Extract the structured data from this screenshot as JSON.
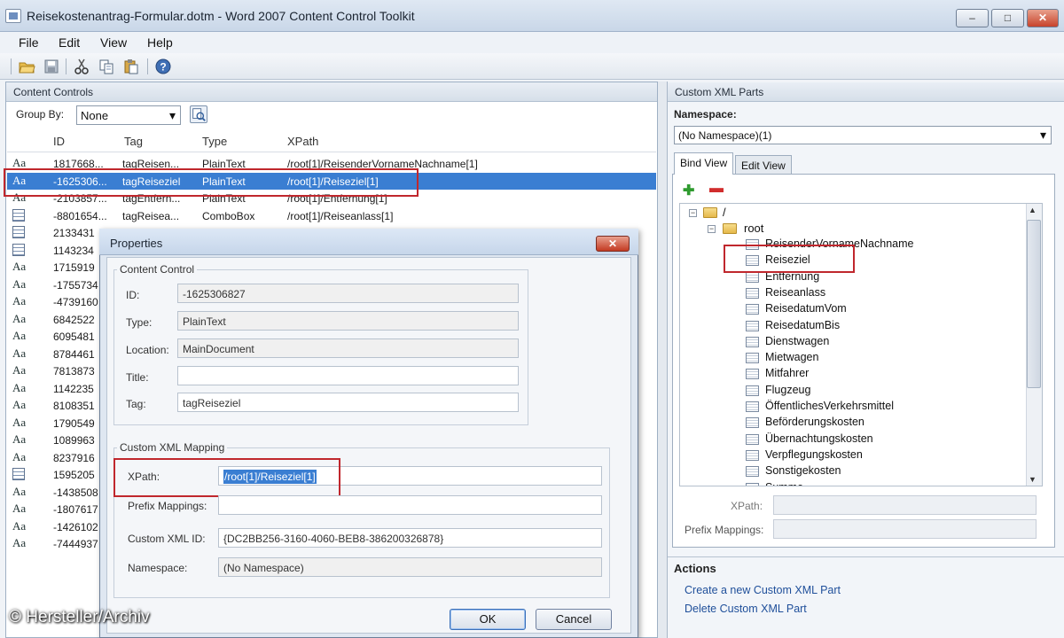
{
  "window": {
    "title": "Reisekostenantrag-Formular.dotm - Word 2007 Content Control Toolkit",
    "min": "–",
    "max": "□",
    "close": "✕"
  },
  "menu": [
    "File",
    "Edit",
    "View",
    "Help"
  ],
  "toolbar_icons": [
    "open-folder-icon",
    "save-icon",
    "cut-icon",
    "copy-icon",
    "paste-icon",
    "help-icon"
  ],
  "content_controls": {
    "header": "Content Controls",
    "group_by_label": "Group By:",
    "group_by_value": "None",
    "columns": [
      "ID",
      "Tag",
      "Type",
      "XPath"
    ],
    "rows": [
      {
        "icon": "Aa",
        "id": "1817668...",
        "tag": "tagReisen...",
        "type": "PlainText",
        "xpath": "/root[1]/ReisenderVornameNachname[1]"
      },
      {
        "icon": "Aa",
        "id": "-1625306...",
        "tag": "tagReiseziel",
        "type": "PlainText",
        "xpath": "/root[1]/Reiseziel[1]",
        "selected": true
      },
      {
        "icon": "Aa",
        "id": "-2103857...",
        "tag": "tagEntfern...",
        "type": "PlainText",
        "xpath": "/root[1]/Entfernung[1]"
      },
      {
        "icon": "combo",
        "id": "-8801654...",
        "tag": "tagReisea...",
        "type": "ComboBox",
        "xpath": "/root[1]/Reiseanlass[1]"
      },
      {
        "icon": "combo",
        "id": "2133431",
        "tag": "",
        "type": "",
        "xpath": ""
      },
      {
        "icon": "combo",
        "id": "1143234",
        "tag": "",
        "type": "",
        "xpath": ""
      },
      {
        "icon": "Aa",
        "id": "1715919",
        "tag": "",
        "type": "",
        "xpath": ""
      },
      {
        "icon": "Aa",
        "id": "-1755734",
        "tag": "",
        "type": "",
        "xpath": ""
      },
      {
        "icon": "Aa",
        "id": "-4739160",
        "tag": "",
        "type": "",
        "xpath": ""
      },
      {
        "icon": "Aa",
        "id": "6842522",
        "tag": "",
        "type": "",
        "xpath": ""
      },
      {
        "icon": "Aa",
        "id": "6095481",
        "tag": "",
        "type": "",
        "xpath": ""
      },
      {
        "icon": "Aa",
        "id": "8784461",
        "tag": "",
        "type": "",
        "xpath": ""
      },
      {
        "icon": "Aa",
        "id": "7813873",
        "tag": "",
        "type": "",
        "xpath": ""
      },
      {
        "icon": "Aa",
        "id": "1142235",
        "tag": "",
        "type": "",
        "xpath": ""
      },
      {
        "icon": "Aa",
        "id": "8108351",
        "tag": "",
        "type": "",
        "xpath": ""
      },
      {
        "icon": "Aa",
        "id": "1790549",
        "tag": "",
        "type": "",
        "xpath": ""
      },
      {
        "icon": "Aa",
        "id": "1089963",
        "tag": "",
        "type": "",
        "xpath": ""
      },
      {
        "icon": "Aa",
        "id": "8237916",
        "tag": "",
        "type": "",
        "xpath": ""
      },
      {
        "icon": "combo",
        "id": "1595205",
        "tag": "",
        "type": "",
        "xpath": ""
      },
      {
        "icon": "Aa",
        "id": "-1438508",
        "tag": "",
        "type": "",
        "xpath": ""
      },
      {
        "icon": "Aa",
        "id": "-1807617",
        "tag": "",
        "type": "",
        "xpath": ""
      },
      {
        "icon": "Aa",
        "id": "-1426102",
        "tag": "",
        "type": "",
        "xpath": ""
      },
      {
        "icon": "Aa",
        "id": "-7444937",
        "tag": "",
        "type": "",
        "xpath": ""
      }
    ]
  },
  "properties_dialog": {
    "title": "Properties",
    "close": "✕",
    "content_control_group": "Content Control",
    "id_label": "ID:",
    "id_value": "-1625306827",
    "type_label": "Type:",
    "type_value": "PlainText",
    "location_label": "Location:",
    "location_value": "MainDocument",
    "title_label": "Title:",
    "title_value": "",
    "tag_label": "Tag:",
    "tag_value": "tagReiseziel",
    "mapping_group": "Custom XML Mapping",
    "xpath_label": "XPath:",
    "xpath_value": "/root[1]/Reiseziel[1]",
    "prefix_label": "Prefix Mappings:",
    "prefix_value": "",
    "custom_xml_id_label": "Custom XML ID:",
    "custom_xml_id_value": "{DC2BB256-3160-4060-BEB8-386200326878}",
    "namespace_label": "Namespace:",
    "namespace_value": "(No Namespace)",
    "ok": "OK",
    "cancel": "Cancel"
  },
  "xml_parts": {
    "header": "Custom XML Parts",
    "namespace_label": "Namespace:",
    "namespace_value": "(No Namespace)(1)",
    "tabs": [
      "Bind View",
      "Edit View"
    ],
    "active_tab": "Bind View",
    "tree_root": "/",
    "tree_child": "root",
    "nodes": [
      "ReisenderVornameNachname",
      "Reiseziel",
      "Entfernung",
      "Reiseanlass",
      "ReisedatumVom",
      "ReisedatumBis",
      "Dienstwagen",
      "Mietwagen",
      "Mitfahrer",
      "Flugzeug",
      "ÖffentlichesVerkehrsmittel",
      "Beförderungskosten",
      "Übernachtungskosten",
      "Verpflegungskosten",
      "Sonstigekosten",
      "Summe"
    ],
    "xpath_label": "XPath:",
    "prefix_label": "Prefix Mappings:",
    "actions_title": "Actions",
    "actions": [
      "Create a new Custom XML Part",
      "Delete Custom XML Part"
    ]
  },
  "watermark": "© Hersteller/Archiv"
}
